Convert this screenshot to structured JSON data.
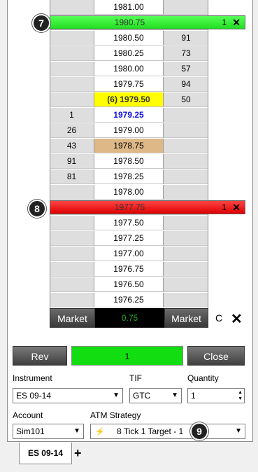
{
  "ladder": {
    "rows": [
      {
        "bid": "",
        "price": "1981.00",
        "ask": ""
      },
      {
        "bid": "",
        "price": "1980.75",
        "ask": ""
      },
      {
        "bid": "",
        "price": "1980.50",
        "ask": "91"
      },
      {
        "bid": "",
        "price": "1980.25",
        "ask": "73"
      },
      {
        "bid": "",
        "price": "1980.00",
        "ask": "57"
      },
      {
        "bid": "",
        "price": "1979.75",
        "ask": "94"
      },
      {
        "bid": "",
        "price": "(6) 1979.50",
        "ask": "50"
      },
      {
        "bid": "1",
        "price": "1979.25",
        "ask": ""
      },
      {
        "bid": "26",
        "price": "1979.00",
        "ask": ""
      },
      {
        "bid": "43",
        "price": "1978.75",
        "ask": ""
      },
      {
        "bid": "91",
        "price": "1978.50",
        "ask": ""
      },
      {
        "bid": "81",
        "price": "1978.25",
        "ask": ""
      },
      {
        "bid": "",
        "price": "1978.00",
        "ask": ""
      },
      {
        "bid": "",
        "price": "1977.75",
        "ask": ""
      },
      {
        "bid": "",
        "price": "1977.50",
        "ask": ""
      },
      {
        "bid": "",
        "price": "1977.25",
        "ask": ""
      },
      {
        "bid": "",
        "price": "1977.00",
        "ask": ""
      },
      {
        "bid": "",
        "price": "1976.75",
        "ask": ""
      },
      {
        "bid": "",
        "price": "1976.50",
        "ask": ""
      },
      {
        "bid": "",
        "price": "1976.25",
        "ask": ""
      }
    ]
  },
  "orders": {
    "target": {
      "price": "1980.75",
      "qty": "1",
      "badge": "7"
    },
    "stop": {
      "price": "1977.75",
      "qty": "1",
      "badge": "8"
    }
  },
  "bottom_row": {
    "market_buy": "Market",
    "pnl": "0.75",
    "market_sell": "Market",
    "c_label": "C"
  },
  "actions": {
    "rev": "Rev",
    "qty": "1",
    "close": "Close"
  },
  "form": {
    "instrument_label": "Instrument",
    "instrument_value": "ES 09-14",
    "tif_label": "TIF",
    "tif_value": "GTC",
    "quantity_label": "Quantity",
    "quantity_value": "1",
    "account_label": "Account",
    "account_value": "Sim101",
    "atm_label": "ATM Strategy",
    "atm_value": "8 Tick 1 Target - 1",
    "atm_badge": "9"
  },
  "tabs": {
    "active": "ES 09-14",
    "add": "+"
  },
  "colors": {
    "target": "#22dd22",
    "stop": "#dd0000",
    "last_price": "#1010e0",
    "highlight": "#ffff00"
  }
}
